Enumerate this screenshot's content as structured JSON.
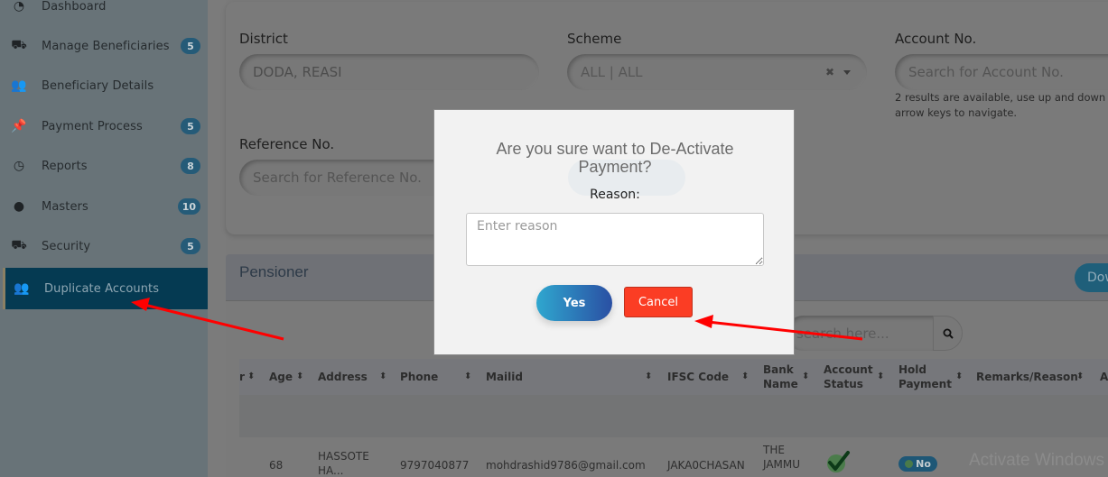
{
  "sidebar": {
    "items": [
      {
        "label": "Dashboard",
        "icon": "dashboard-icon",
        "badge": null
      },
      {
        "label": "Manage Beneficiaries",
        "icon": "taxi-icon",
        "badge": "5"
      },
      {
        "label": "Beneficiary Details",
        "icon": "users-icon",
        "badge": null
      },
      {
        "label": "Payment Process",
        "icon": "pushpin-icon",
        "badge": "5"
      },
      {
        "label": "Reports",
        "icon": "clock-icon",
        "badge": "8"
      },
      {
        "label": "Masters",
        "icon": "globe-icon",
        "badge": "10"
      },
      {
        "label": "Security",
        "icon": "truck-icon",
        "badge": "5"
      },
      {
        "label": "Duplicate Accounts",
        "icon": "users-icon",
        "badge": null,
        "active": true
      }
    ]
  },
  "filters": {
    "district": {
      "label": "District",
      "value": "DODA, REASI"
    },
    "scheme": {
      "label": "Scheme",
      "value": "ALL | ALL",
      "clear": "✖"
    },
    "account": {
      "label": "Account No.",
      "placeholder": "Search for Account No.",
      "hint": "2 results are available, use up and down arrow keys to navigate."
    },
    "reference": {
      "label": "Reference No.",
      "placeholder": "Search for Reference No."
    }
  },
  "pensioner": {
    "title": "Pensioner",
    "download_label": "Dow",
    "search_placeholder": "search here..."
  },
  "table": {
    "columns": [
      "r",
      "Age",
      "Address",
      "Phone",
      "Mailid",
      "IFSC Code",
      "Bank Name",
      "Account Status",
      "Hold Payment",
      "Remarks/Reason",
      "A"
    ],
    "rows": [
      {
        "age": "68",
        "address": "HASSOTE HA...",
        "phone": "9797040877",
        "mailid": "mohdrashid9786@gmail.com",
        "ifsc": "JAKA0CHASAN",
        "bank": "THE JAMMU",
        "account_status": "active",
        "hold_payment": "No"
      }
    ]
  },
  "modal": {
    "question": "Are you sure want to De-Activate Payment?",
    "reason_label": "Reason:",
    "reason_placeholder": "Enter reason",
    "yes_label": "Yes",
    "cancel_label": "Cancel"
  },
  "watermark": "Activate Windows",
  "colors": {
    "sidebar_active": "#053a52",
    "badge": "#255b78",
    "cancel": "#fb3d24",
    "yes_gradient_start": "#2fa7cf",
    "yes_gradient_end": "#2a4fa3",
    "annotation_arrow": "#ff0000"
  }
}
